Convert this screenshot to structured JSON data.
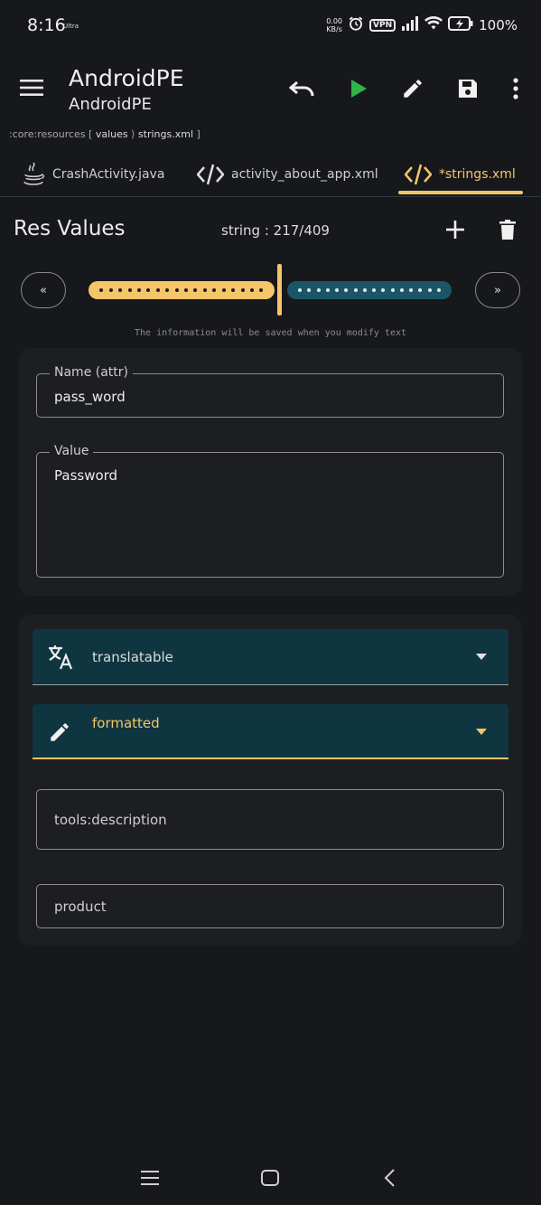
{
  "status_bar": {
    "time": "8:16",
    "carrier_tag": "Ultra",
    "speed_value": "0.00",
    "speed_unit": "KB/s",
    "vpn": "VPN",
    "battery": "100%"
  },
  "app_bar": {
    "title": "AndroidPE",
    "subtitle": "AndroidPE"
  },
  "breadcrumb": {
    "module": ":core:resources",
    "sep1": "[",
    "folder": "values",
    "sep2": "⟩",
    "file": "strings.xml",
    "sep3": "]"
  },
  "tabs": [
    {
      "label": "CrashActivity.java",
      "icon": "java-icon"
    },
    {
      "label": "activity_about_app.xml",
      "icon": "code-icon"
    },
    {
      "label": "*strings.xml",
      "icon": "code-icon",
      "active": true
    }
  ],
  "res_values": {
    "title": "Res Values",
    "counter": "string : 217/409",
    "prev": "«",
    "next": "»",
    "progress": 0.53,
    "note": "The information will be saved when you modify text"
  },
  "fields": {
    "name_label": "Name (attr)",
    "name_value": "pass_word",
    "value_label": "Value",
    "value_value": "Password"
  },
  "options": {
    "translatable": "translatable",
    "formatted": "formatted",
    "tools_description_placeholder": "tools:description",
    "product_placeholder": "product"
  },
  "colors": {
    "accent": "#f5c56a",
    "teal": "#0f3540",
    "play_green": "#2fb34a"
  }
}
